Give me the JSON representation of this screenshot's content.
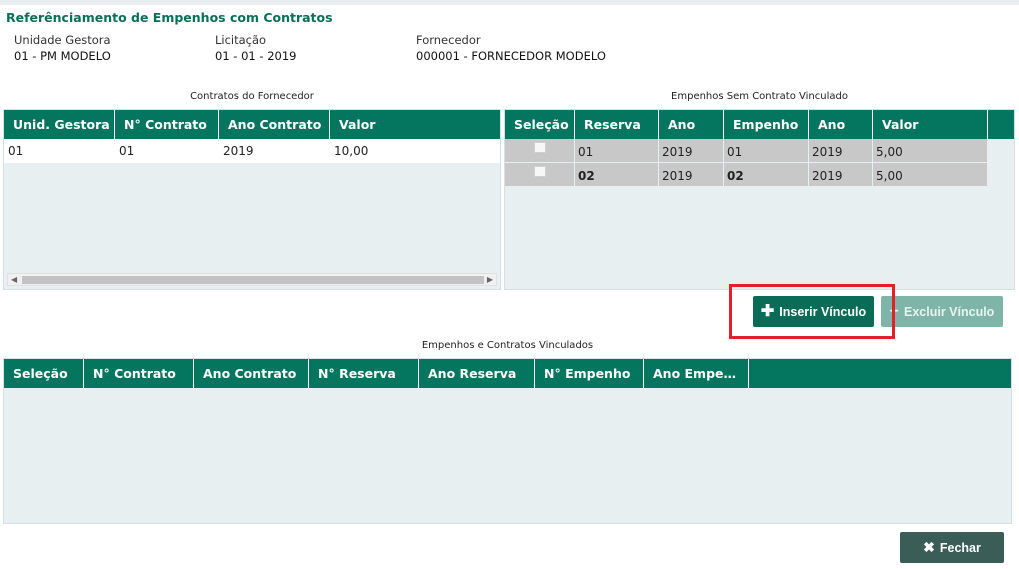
{
  "title": "Referênciamento de Empenhos com Contratos",
  "info": {
    "unidade": {
      "label": "Unidade Gestora",
      "value": "01 - PM MODELO"
    },
    "licitacao": {
      "label": "Licitação",
      "value": "01 - 01 - 2019"
    },
    "fornecedor": {
      "label": "Fornecedor",
      "value": "000001 - FORNECEDOR MODELO"
    }
  },
  "contratos": {
    "caption": "Contratos do Fornecedor",
    "headers": [
      "Unid. Gestora",
      "N° Contrato",
      "Ano Contrato",
      "Valor"
    ],
    "rows": [
      [
        "01",
        "01",
        "2019",
        "10,00"
      ]
    ]
  },
  "empenhos": {
    "caption": "Empenhos Sem Contrato Vinculado",
    "headers": [
      "Seleção",
      "Reserva",
      "Ano",
      "Empenho",
      "Ano",
      "Valor"
    ],
    "rows": [
      [
        "01",
        "2019",
        "01",
        "2019",
        "5,00"
      ],
      [
        "02",
        "2019",
        "02",
        "2019",
        "5,00"
      ]
    ]
  },
  "buttons": {
    "inserir": "Inserir Vínculo",
    "excluir": "Excluir Vínculo",
    "fechar": "Fechar"
  },
  "vinculados": {
    "caption": "Empenhos e Contratos Vinculados",
    "headers": [
      "Seleção",
      "N° Contrato",
      "Ano Contrato",
      "N° Reserva",
      "Ano Reserva",
      "N° Empenho",
      "Ano Empe…"
    ]
  },
  "colors": {
    "accent": "#04755e",
    "highlight": "#e3202a"
  }
}
